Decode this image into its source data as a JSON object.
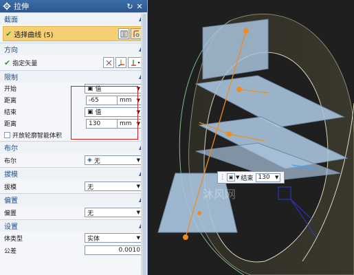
{
  "dialog": {
    "title": "拉伸",
    "reset_icon": "reset-icon",
    "close_icon": "close-icon"
  },
  "section": {
    "header": "截面",
    "select_curve": "选择曲线 (5)"
  },
  "direction": {
    "header": "方向",
    "specify_vector": "指定矢量"
  },
  "limits": {
    "header": "限制",
    "start_label": "开始",
    "start_value": "值",
    "start_dist_label": "距离",
    "start_dist": "-65",
    "start_unit": "mm",
    "end_label": "结束",
    "end_value": "值",
    "end_dist_label": "距离",
    "end_dist": "130",
    "end_unit": "mm",
    "open_profile": "开放轮廓智能体积"
  },
  "boolean": {
    "header": "布尔",
    "label": "布尔",
    "value": "无"
  },
  "draft": {
    "header": "拔模",
    "label": "拔模",
    "value": "无"
  },
  "offset": {
    "header": "偏置",
    "label": "偏置",
    "value": "无"
  },
  "settings": {
    "header": "设置",
    "body_type_label": "体类型",
    "body_type": "实体",
    "tolerance_label": "公差",
    "tolerance": "0.0010"
  },
  "floating": {
    "label": "结束",
    "value": "130"
  },
  "watermark": "沐风网",
  "colors": {
    "title_bg": "#2b578f",
    "highlight": "#f4cf73",
    "header_text": "#1f4f8f",
    "red_box": "#d21c1c",
    "handle": "#f08a24",
    "plane": "#a9c3dc"
  }
}
